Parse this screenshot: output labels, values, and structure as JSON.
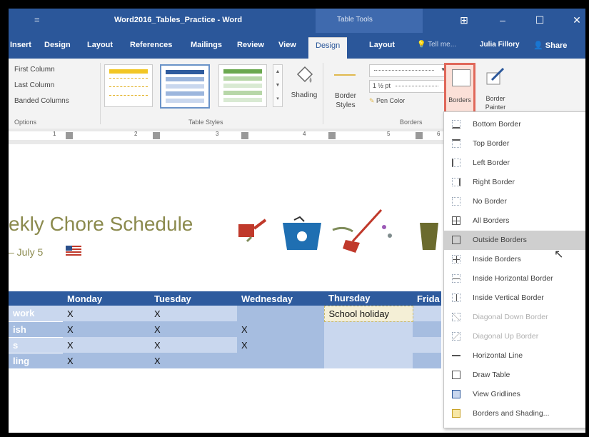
{
  "titlebar": {
    "quick_access": "=",
    "document_title": "Word2016_Tables_Practice - Word",
    "context_label": "Table Tools",
    "minimize": "–",
    "maximize": "☐",
    "close": "✕",
    "ribbon_display": "⊞"
  },
  "tabs": {
    "items": [
      "Insert",
      "Design",
      "Layout",
      "References",
      "Mailings",
      "Review",
      "View"
    ],
    "active_tab": "Design",
    "context_layout": "Layout",
    "tell_me": "Tell me...",
    "user": "Julia Fillory",
    "share": "Share"
  },
  "ribbon": {
    "options": [
      "First Column",
      "Last Column",
      "Banded Columns"
    ],
    "options_group": "Options",
    "styles_group": "Table Styles",
    "shading": "Shading",
    "border_styles": "Border Styles",
    "pen_weight": "1 ½ pt",
    "pen_color": "Pen Color",
    "borders_btn": "Borders",
    "border_painter": "Border Painter",
    "borders_group": "Borders"
  },
  "ruler": {
    "numbers": [
      "1",
      "2",
      "3",
      "4",
      "5",
      "6"
    ]
  },
  "document": {
    "title": "ekly Chore Schedule",
    "subtitle": "– July 5",
    "table": {
      "headers": [
        "",
        "Monday",
        "Tuesday",
        "Wednesday",
        "Thursday",
        "Frida"
      ],
      "rows": [
        [
          "work",
          "X",
          "X",
          "",
          "School holiday",
          ""
        ],
        [
          "ish",
          "X",
          "X",
          "X",
          "",
          ""
        ],
        [
          "s",
          "X",
          "X",
          "X",
          "",
          ""
        ],
        [
          "ling",
          "X",
          "X",
          "",
          "",
          ""
        ]
      ]
    }
  },
  "menu": {
    "items": [
      {
        "label": "Bottom Border",
        "icon": "bottom-border-icon"
      },
      {
        "label": "Top Border",
        "icon": "top-border-icon"
      },
      {
        "label": "Left Border",
        "icon": "left-border-icon"
      },
      {
        "label": "Right Border",
        "icon": "right-border-icon"
      },
      {
        "label": "No Border",
        "icon": "no-border-icon"
      },
      {
        "label": "All Borders",
        "icon": "all-borders-icon"
      },
      {
        "label": "Outside Borders",
        "icon": "outside-borders-icon"
      },
      {
        "label": "Inside Borders",
        "icon": "inside-borders-icon"
      },
      {
        "label": "Inside Horizontal Border",
        "icon": "inside-horizontal-border-icon"
      },
      {
        "label": "Inside Vertical Border",
        "icon": "inside-vertical-border-icon"
      },
      {
        "label": "Diagonal Down Border",
        "icon": "diagonal-down-border-icon"
      },
      {
        "label": "Diagonal Up Border",
        "icon": "diagonal-up-border-icon"
      },
      {
        "label": "Horizontal Line",
        "icon": "horizontal-line-icon"
      },
      {
        "label": "Draw Table",
        "icon": "draw-table-icon"
      },
      {
        "label": "View Gridlines",
        "icon": "view-gridlines-icon"
      },
      {
        "label": "Borders and Shading...",
        "icon": "borders-and-shading-icon"
      }
    ],
    "highlighted": "Outside Borders"
  },
  "colors": {
    "word_blue": "#2b579a",
    "table_header": "#2e5b9e",
    "row_light": "#c9d7ee",
    "row_mid": "#a6bde0",
    "heading_olive": "#8b8a4d",
    "borders_highlight": "#e0685a"
  }
}
